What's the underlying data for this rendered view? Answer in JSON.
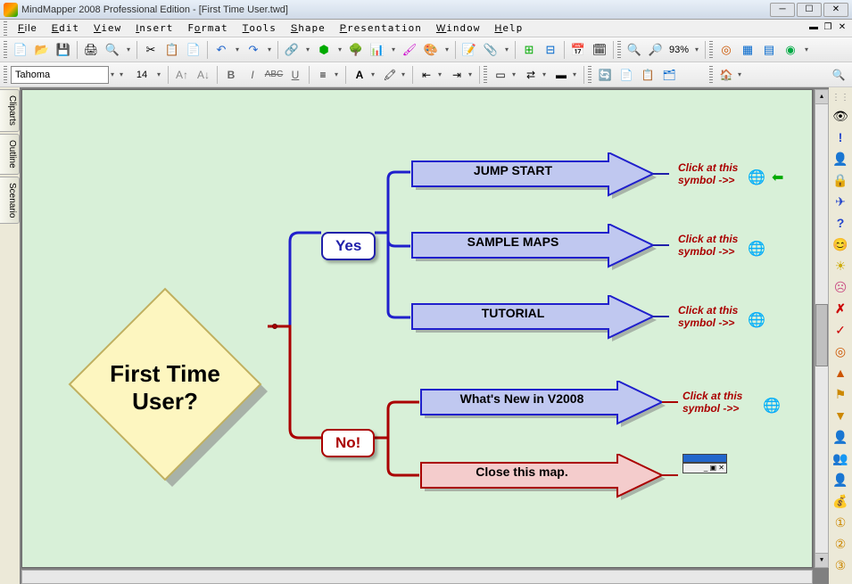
{
  "titlebar": {
    "text": "MindMapper 2008 Professional Edition - [First Time User.twd]"
  },
  "menu": {
    "file": "File",
    "edit": "Edit",
    "view": "View",
    "insert": "Insert",
    "format": "Format",
    "tools": "Tools",
    "shape": "Shape",
    "presentation": "Presentation",
    "window": "Window",
    "help": "Help"
  },
  "toolbar": {
    "zoom": "93%"
  },
  "format_bar": {
    "font": "Tahoma",
    "size": "14"
  },
  "left_tabs": {
    "cliparts": "Cliparts",
    "outline": "Outline",
    "scenario": "Scenario"
  },
  "map": {
    "root": "First Time\nUser?",
    "yes": "Yes",
    "no": "No!",
    "jump_start": "JUMP START",
    "sample_maps": "SAMPLE MAPS",
    "tutorial": "TUTORIAL",
    "whats_new": "What's New in V2008",
    "close_map": "Close this map.",
    "click_hint": "Click at this symbol ->>"
  }
}
